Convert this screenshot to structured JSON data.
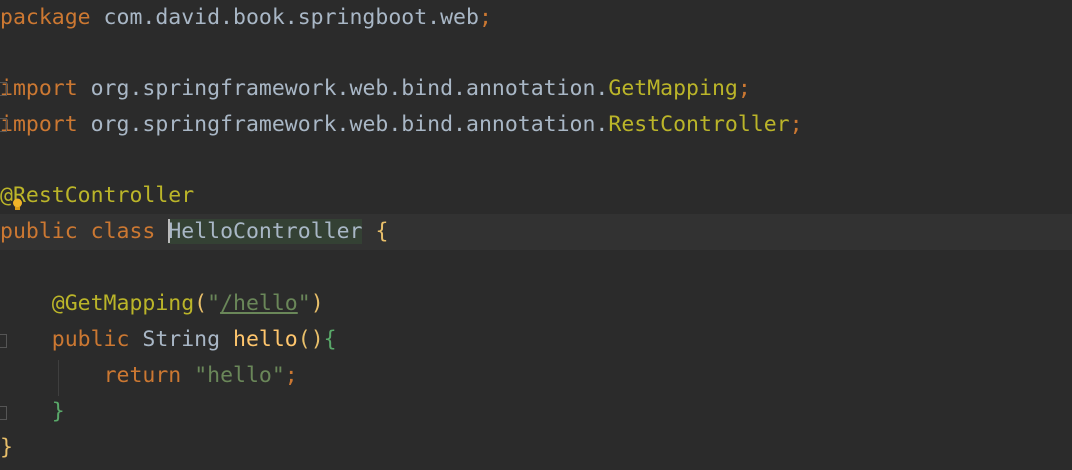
{
  "code": {
    "package_kw": "package",
    "package_name": " com.david.book.springboot.web",
    "semicolon": ";",
    "import_kw": "import",
    "import1_pkg": " org.springframework.web.bind.annotation.",
    "import1_cls": "GetMapping",
    "import2_pkg": " org.springframework.web.bind.annotation.",
    "import2_cls": "RestController",
    "class_annotation": "@RestController",
    "public_kw": "public",
    "class_kw": "class",
    "class_name": "HelloController",
    "open_brace": "{",
    "method_annotation": "@GetMapping",
    "open_paren": "(",
    "quote": "\"",
    "mapping_path": "/hello",
    "close_paren": ")",
    "return_type": "String",
    "method_name": "hello",
    "method_parens": "()",
    "return_kw": "return",
    "return_value": "\"hello\"",
    "close_brace": "}"
  },
  "colors": {
    "background": "#2b2b2b",
    "keyword": "#cc7832",
    "annotation": "#bbb529",
    "string": "#6a8759",
    "method": "#ffc66d",
    "text": "#a9b7c6"
  }
}
